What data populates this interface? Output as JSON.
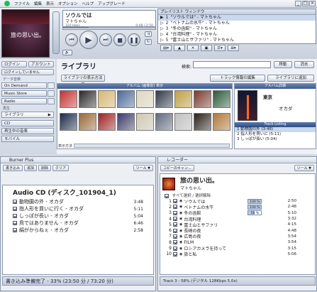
{
  "menubar": {
    "items": [
      "ファイル",
      "編集",
      "表示",
      "オプション",
      "ヘルプ",
      "アップグレード"
    ]
  },
  "player": {
    "title": "ソウルでは",
    "artist": "マトちゃん",
    "bitrate": "320 kbps",
    "time": "0:48 / 2:50",
    "progress": 0.28,
    "art_text": "旅の思い出。",
    "artist_btn": "ログイン",
    "account_btn": "アカウント"
  },
  "playlist": {
    "header": "プレイリスト ウィンドウ",
    "rows": [
      {
        "num": "1",
        "text": "\"ソウルでは\" - マトちゃん"
      },
      {
        "num": "2",
        "text": "\"ベトナムの水牛\" - マトちゃん"
      },
      {
        "num": "3",
        "text": "\"冬の函館\" - マトちゃん"
      },
      {
        "num": "4",
        "text": "\"台湾料理\" - マトちゃん"
      },
      {
        "num": "5",
        "text": "\"富士山とサファリ\" - マトちゃん"
      }
    ]
  },
  "nav": {
    "login_info": "ログインしていません",
    "data_label": "データ音楽",
    "items": [
      "On Demand",
      "Music Store",
      "Radio"
    ],
    "play_label": "再生",
    "library_item": "ライブラリ",
    "cd_item": "CD",
    "nowplaying_item": "再生中の音楽",
    "more_item": "モバイル"
  },
  "library": {
    "title": "ライブラリ",
    "view_btn": "ライブラリの表示方法 ▼",
    "search_label": "検索:",
    "move_btn": "移動",
    "clear_btn": "消去",
    "trackinfo_btn": "トラック情報の編集",
    "addto_btn": "ライブラリに追加",
    "albums_header": "アルバム (画像別) 表示",
    "detail_header": "アルバム詳細",
    "tracklist_header": "Track Listing",
    "album_city": "東京",
    "album_artist": "オカダ",
    "tracks": [
      {
        "text": "1 動物園の外 (3:48)",
        "sel": true
      },
      {
        "text": "2 指人形を買いに (5:11)",
        "sel": false
      },
      {
        "text": "3 しっぽが長い (5:04)",
        "sel": false
      }
    ],
    "sort_label": "表示方法"
  },
  "burner": {
    "title": "Burner Plus",
    "toolbar": [
      "書き込み",
      "追加",
      "削除",
      "クリア"
    ],
    "tools_btn": "ツール ▼",
    "cd_title": "Audio CD (ディスク_101904_1)",
    "tracks": [
      {
        "title": "動物園の外 - オカダ",
        "len": "3:48"
      },
      {
        "title": "指人形を買いに行く - オカダ",
        "len": "5:11"
      },
      {
        "title": "しっぽが長い - オカダ",
        "len": "5:04"
      },
      {
        "title": "鳥ではありません - オカダ",
        "len": "6:46"
      },
      {
        "title": "絹がからねぇ - オカダ",
        "len": "2:58"
      }
    ],
    "status": "書き込み準備完了 - 33% (23:50 分 / 73:20 分)"
  },
  "recorder": {
    "title": "レコーダー",
    "copy_btn": "コピーのキャン...",
    "tools_btn": "ツール ▼",
    "album_title": "旅の思い出。",
    "album_artist": "マトちゃん",
    "select_all": "すべて選択 / 選択解除",
    "tracks": [
      {
        "n": "1",
        "title": "ソウルでは",
        "pct": "100 %",
        "state": "done",
        "len": "2:50"
      },
      {
        "n": "2",
        "title": "ベトナムの水牛",
        "pct": "100 %",
        "state": "done",
        "len": "2:48"
      },
      {
        "n": "3",
        "title": "冬の函館",
        "pct": "58 %",
        "state": "half",
        "len": "5:10"
      },
      {
        "n": "4",
        "title": "台湾料理",
        "pct": "",
        "state": "",
        "len": "3:32"
      },
      {
        "n": "5",
        "title": "富士山とサファリ",
        "pct": "",
        "state": "",
        "len": "4:15"
      },
      {
        "n": "6",
        "title": "長崎の夜",
        "pct": "",
        "state": "",
        "len": "4:48"
      },
      {
        "n": "7",
        "title": "広島の夜",
        "pct": "",
        "state": "",
        "len": "3:54"
      },
      {
        "n": "8",
        "title": "FILM",
        "pct": "",
        "state": "",
        "len": "3:54"
      },
      {
        "n": "9",
        "title": "ロシアカメラを持って",
        "pct": "",
        "state": "",
        "len": "3:15"
      },
      {
        "n": "10",
        "title": "旅と私",
        "pct": "",
        "state": "",
        "len": "5:06"
      }
    ],
    "status": "Track 3 - 58% (デジタル 128Kbps 5.0x)"
  },
  "colors": {
    "accent": "#4c8fd8",
    "header": "#3c5a8e"
  }
}
